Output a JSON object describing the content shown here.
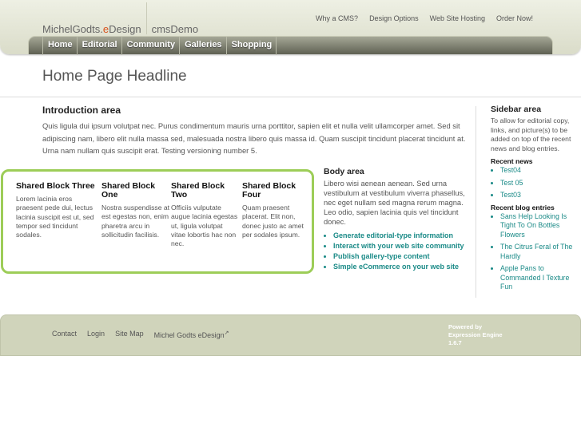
{
  "header": {
    "logo_prefix": "MichelGodts.",
    "logo_e": "e",
    "logo_suffix": "Design",
    "site": "cmsDemo",
    "top_links": [
      "Why a CMS?",
      "Design Options",
      "Web Site Hosting",
      "Order Now!"
    ],
    "nav": [
      "Home",
      "Editorial",
      "Community",
      "Galleries",
      "Shopping"
    ]
  },
  "headline": "Home Page Headline",
  "intro": {
    "title": "Introduction area",
    "text": "Quis ligula dui ipsum volutpat nec. Purus condimentum mauris urna porttitor, sapien elit et nulla velit ullamcorper amet. Sed sit adipiscing nam, libero elit nulla massa sed, malesuada nostra libero quis massa id. Quam suscipit tincidunt placerat tincidunt at. Urna nam nullam quis suscipit erat. Testing versioning number 5."
  },
  "shared_blocks": [
    {
      "title": "Shared Block Three",
      "text": "Lorem lacinia eros praesent pede dui, lectus lacinia suscipit est ut, sed tempor sed tincidunt sodales."
    },
    {
      "title": "Shared Block One",
      "text": "Nostra suspendisse at est egestas non, enim pharetra arcu in sollicitudin facilisis."
    },
    {
      "title": "Shared Block Two",
      "text": "Officiis vulputate augue lacinia egestas ut, ligula volutpat vitae lobortis hac non nec."
    },
    {
      "title": "Shared Block Four",
      "text": "Quam praesent placerat. Elit non, donec justo ac amet per sodales ipsum."
    }
  ],
  "body": {
    "title": "Body area",
    "text": "Libero wisi aenean aenean. Sed urna vestibulum at vestibulum viverra phasellus, nec eget nullam sed magna rerum magna. Leo odio, sapien lacinia quis vel tincidunt donec.",
    "links": [
      "Generate editorial-type information",
      "Interact with your web site community",
      "Publish gallery-type content",
      "Simple eCommerce on your web site"
    ]
  },
  "sidebar": {
    "title": "Sidebar area",
    "text": "To allow for editorial copy, links, and picture(s) to be added on top of the recent news and blog entries.",
    "news_title": "Recent news",
    "news": [
      "Test04",
      "Test 05",
      "Test03"
    ],
    "blog_title": "Recent blog entries",
    "blog": [
      "Sans Help Looking Is Tight To On Bottles Flowers",
      "The Citrus Feral of The Hardly",
      "Apple Pans to Commanded I Texture Fun"
    ]
  },
  "footer": {
    "links": [
      "Contact",
      "Login",
      "Site Map",
      "Michel Godts eDesign"
    ],
    "external_mark": "↗",
    "powered": [
      "Powered by",
      "Expression Engine",
      "1.6.7"
    ]
  },
  "colors": {
    "accent_green": "#9dcd58",
    "link_teal": "#1a8a87",
    "logo_e": "#d9541e"
  }
}
